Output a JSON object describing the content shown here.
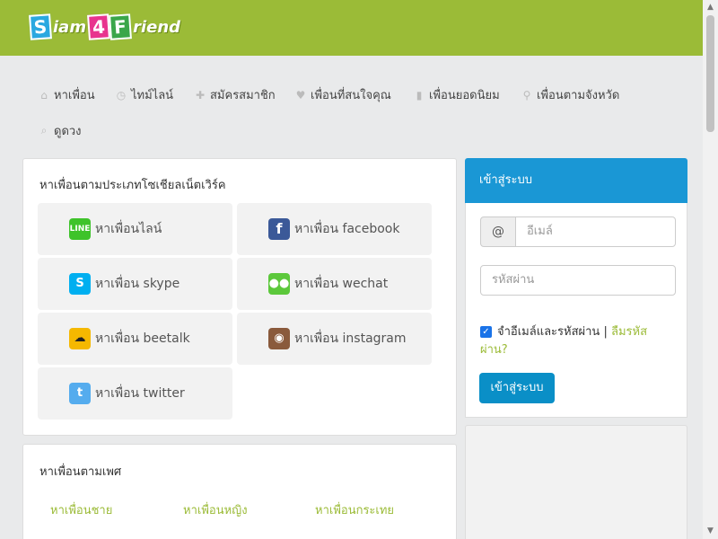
{
  "header": {
    "logo_parts": [
      "S",
      "iam",
      "4",
      "F",
      "riend"
    ],
    "brand_color": "#9bbb37"
  },
  "nav": {
    "items": [
      {
        "label": "หาเพื่อน",
        "icon": "home-icon"
      },
      {
        "label": "ไทม์ไลน์",
        "icon": "clock-icon"
      },
      {
        "label": "สมัครสมาชิก",
        "icon": "plus-icon"
      },
      {
        "label": "เพื่อนที่สนใจคุณ",
        "icon": "heart-icon"
      },
      {
        "label": "เพื่อนยอดนิยม",
        "icon": "bookmark-icon"
      },
      {
        "label": "เพื่อนตามจังหวัด",
        "icon": "map-marker-icon"
      },
      {
        "label": "ดูดวง",
        "icon": "search-icon"
      }
    ]
  },
  "social": {
    "title": "หาเพื่อนตามประเภทโซเชียลเน็ตเวิร์ค",
    "buttons": [
      {
        "label": "หาเพื่อนไลน์",
        "icon": "line-icon",
        "color": "#3ec32a"
      },
      {
        "label": "หาเพื่อน facebook",
        "icon": "facebook-icon",
        "color": "#3b5998"
      },
      {
        "label": "หาเพื่อน skype",
        "icon": "skype-icon",
        "color": "#00aff0"
      },
      {
        "label": "หาเพื่อน wechat",
        "icon": "wechat-icon",
        "color": "#5cc83b"
      },
      {
        "label": "หาเพื่อน beetalk",
        "icon": "beetalk-icon",
        "color": "#f5b800"
      },
      {
        "label": "หาเพื่อน instagram",
        "icon": "instagram-icon",
        "color": "#8a5a3c"
      },
      {
        "label": "หาเพื่อน twitter",
        "icon": "twitter-icon",
        "color": "#55acee"
      }
    ]
  },
  "gender": {
    "title": "หาเพื่อนตามเพศ",
    "links": [
      "หาเพื่อนชาย",
      "หาเพื่อนหญิง",
      "หาเพื่อนกระเทย"
    ]
  },
  "login": {
    "title": "เข้าสู่ระบบ",
    "at_symbol": "@",
    "email_placeholder": "อีเมล์",
    "password_placeholder": "รหัสผ่าน",
    "remember_label": "จำอีเมล์และรหัสผ่าน",
    "separator": "|",
    "forgot_label": "ลืมรหัสผ่าน?",
    "submit_label": "เข้าสู่ระบบ",
    "accent_color": "#1a97d5"
  }
}
